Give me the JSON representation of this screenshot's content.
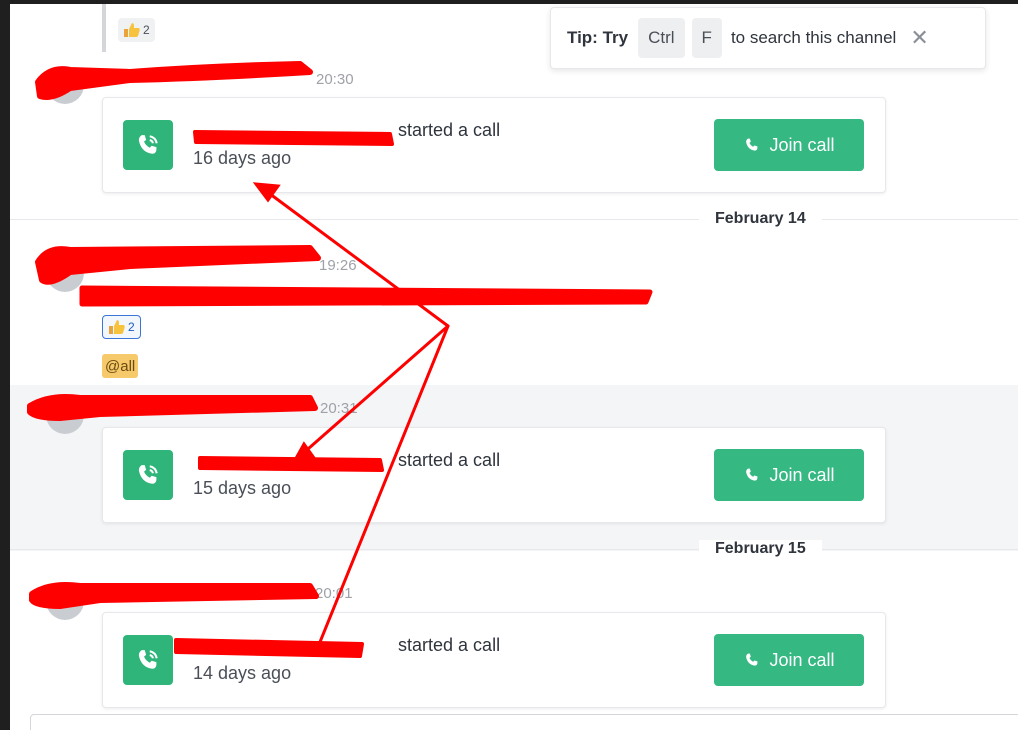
{
  "tip": {
    "lead": "Tip: Try",
    "key1": "Ctrl",
    "key2": "F",
    "rest": "to search this channel",
    "close": "✕"
  },
  "reactions": {
    "top_count": "2",
    "mid_count": "2"
  },
  "messages": [
    {
      "time": "20:30",
      "call_suffix": "started a call",
      "call_age": "16 days ago",
      "join_label": "Join call"
    },
    {
      "time": "19:26"
    },
    {
      "time": "20:31",
      "call_suffix": "started a call",
      "call_age": "15 days ago",
      "join_label": "Join call"
    },
    {
      "time": "20:01",
      "call_suffix": "started a call",
      "call_age": "14 days ago",
      "join_label": "Join call"
    }
  ],
  "mention": "@all",
  "dates": {
    "d1": "February 14",
    "d2": "February 15"
  },
  "colors": {
    "accent_green": "#35b882",
    "annotation_red": "#ff0000"
  }
}
